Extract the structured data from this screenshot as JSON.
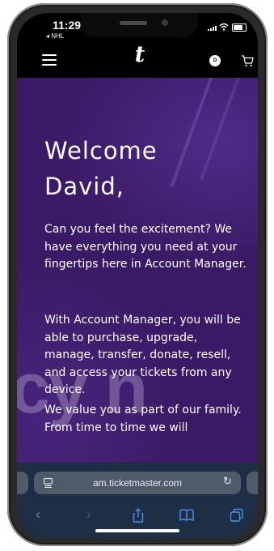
{
  "status_bar": {
    "time": "11:29",
    "back_app": "◂ NHL"
  },
  "app_bar": {
    "logo_text": "t",
    "avatar_initial": "D",
    "icons": [
      "menu-icon",
      "avatar-icon",
      "cart-icon"
    ]
  },
  "main": {
    "welcome_line1": "Welcome",
    "welcome_line2": "David,",
    "paragraphs": [
      "Can you feel the excitement? We have everything you need at your fingertips here in Account Manager.",
      "With Account Manager, you will be able to purchase, upgrade, manage, transfer, donate, resell, and access your tickets from any device.",
      "We value you as part of our family. From time to time we will"
    ],
    "background_text": "cy n"
  },
  "browser": {
    "url": "am.ticketmaster.com",
    "toolbar_icons": [
      "back-icon",
      "forward-icon",
      "share-icon",
      "bookmarks-icon",
      "tabs-icon"
    ]
  },
  "colors": {
    "content_bg": "#3a1a66",
    "topbar_bg": "#000000",
    "safari_bg": "#1e2e45",
    "toolbar_accent": "#4a8ff0"
  }
}
